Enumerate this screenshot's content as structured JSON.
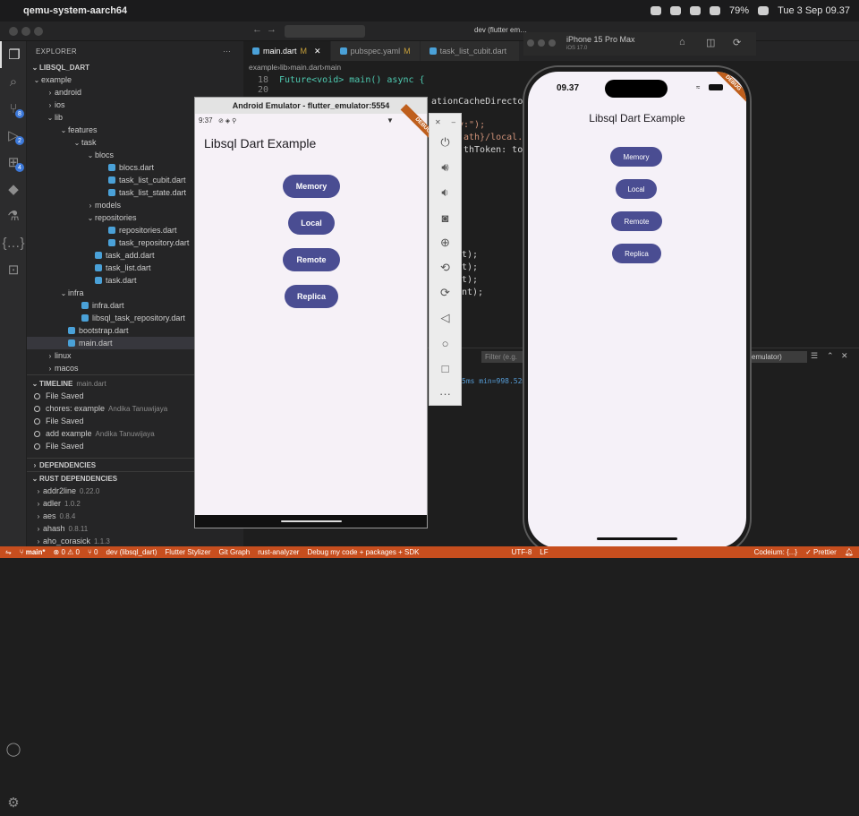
{
  "menubar": {
    "app": "qemu-system-aarch64",
    "battery": "79%",
    "datetime": "Tue 3 Sep  09.37"
  },
  "sidebar": {
    "title": "EXPLORER",
    "root": "LIBSQL_DART",
    "tree": [
      {
        "label": "example",
        "depth": 0,
        "kind": "folder-open"
      },
      {
        "label": "android",
        "depth": 1,
        "kind": "folder"
      },
      {
        "label": "ios",
        "depth": 1,
        "kind": "folder"
      },
      {
        "label": "lib",
        "depth": 1,
        "kind": "folder-open"
      },
      {
        "label": "features",
        "depth": 2,
        "kind": "folder-open"
      },
      {
        "label": "task",
        "depth": 3,
        "kind": "folder-open"
      },
      {
        "label": "blocs",
        "depth": 4,
        "kind": "folder-open"
      },
      {
        "label": "blocs.dart",
        "depth": 5,
        "kind": "file"
      },
      {
        "label": "task_list_cubit.dart",
        "depth": 5,
        "kind": "file"
      },
      {
        "label": "task_list_state.dart",
        "depth": 5,
        "kind": "file"
      },
      {
        "label": "models",
        "depth": 4,
        "kind": "folder"
      },
      {
        "label": "repositories",
        "depth": 4,
        "kind": "folder-open"
      },
      {
        "label": "repositories.dart",
        "depth": 5,
        "kind": "file"
      },
      {
        "label": "task_repository.dart",
        "depth": 5,
        "kind": "file"
      },
      {
        "label": "task_add.dart",
        "depth": 4,
        "kind": "file"
      },
      {
        "label": "task_list.dart",
        "depth": 4,
        "kind": "file"
      },
      {
        "label": "task.dart",
        "depth": 4,
        "kind": "file"
      },
      {
        "label": "infra",
        "depth": 2,
        "kind": "folder-open"
      },
      {
        "label": "infra.dart",
        "depth": 3,
        "kind": "file"
      },
      {
        "label": "libsql_task_repository.dart",
        "depth": 3,
        "kind": "file"
      },
      {
        "label": "bootstrap.dart",
        "depth": 2,
        "kind": "file"
      },
      {
        "label": "main.dart",
        "depth": 2,
        "kind": "file",
        "selected": true
      },
      {
        "label": "linux",
        "depth": 1,
        "kind": "folder"
      },
      {
        "label": "macos",
        "depth": 1,
        "kind": "folder"
      }
    ],
    "timeline_title": "TIMELINE",
    "timeline_file": "main.dart",
    "timeline": [
      {
        "label": "File Saved",
        "author": ""
      },
      {
        "label": "chores: example",
        "author": "Andika Tanuwijaya"
      },
      {
        "label": "File Saved",
        "author": ""
      },
      {
        "label": "add example",
        "author": "Andika Tanuwijaya"
      },
      {
        "label": "File Saved",
        "author": ""
      }
    ],
    "deps_title": "DEPENDENCIES",
    "rust_title": "RUST DEPENDENCIES",
    "rust": [
      {
        "name": "addr2line",
        "version": "0.22.0"
      },
      {
        "name": "adler",
        "version": "1.0.2"
      },
      {
        "name": "aes",
        "version": "0.8.4"
      },
      {
        "name": "ahash",
        "version": "0.8.11"
      },
      {
        "name": "aho_corasick",
        "version": "1.1.3"
      }
    ]
  },
  "editor": {
    "tabs": [
      {
        "label": "main.dart",
        "mod": "M",
        "active": true
      },
      {
        "label": "pubspec.yaml",
        "mod": "M",
        "active": false
      },
      {
        "label": "task_list_cubit.dart",
        "mod": "",
        "active": false
      }
    ],
    "breadcrumb": [
      "example",
      "lib",
      "main.dart",
      "main"
    ],
    "lines": [
      {
        "n": "18",
        "text": "Future<void> main() async {"
      },
      {
        "n": "20",
        "text": ""
      }
    ],
    "fragments": [
      "ationCacheDirectory(",
      "y:\");",
      "ath}/local.d",
      "thToken: to",
      "t);",
      "t);",
      "t);",
      "nt);"
    ],
    "panel_filter": "Filter (e.g.",
    "panel_log": "5ms min=998.52m",
    "panel_device": "emulator)"
  },
  "android": {
    "title": "Android Emulator - flutter_emulator:5554",
    "time": "9:37",
    "banner": "DEBUG",
    "app_title": "Libsql Dart Example",
    "buttons": [
      "Memory",
      "Local",
      "Remote",
      "Replica"
    ]
  },
  "iphone": {
    "device": "iPhone 15 Pro Max",
    "os": "iOS 17.0",
    "time": "09.37",
    "banner": "DEBUG",
    "app_title": "Libsql Dart Example",
    "buttons": [
      "Memory",
      "Local",
      "Remote",
      "Replica"
    ]
  },
  "status": {
    "branch": "main*",
    "errors": "0",
    "warnings": "0",
    "ports": "0",
    "device": "dev (libsql_dart)",
    "items": [
      "Flutter Stylizer",
      "Git Graph",
      "rust-analyzer",
      "Debug my code + packages + SDK"
    ],
    "encoding": "UTF-8",
    "eol": "LF",
    "codeium": "Codeium: {...}",
    "prettier": "Prettier"
  },
  "colors": {
    "accent_button": "#4a4d92",
    "status_bar": "#c74e1e",
    "debug_ribbon": "#bf5f1d"
  }
}
